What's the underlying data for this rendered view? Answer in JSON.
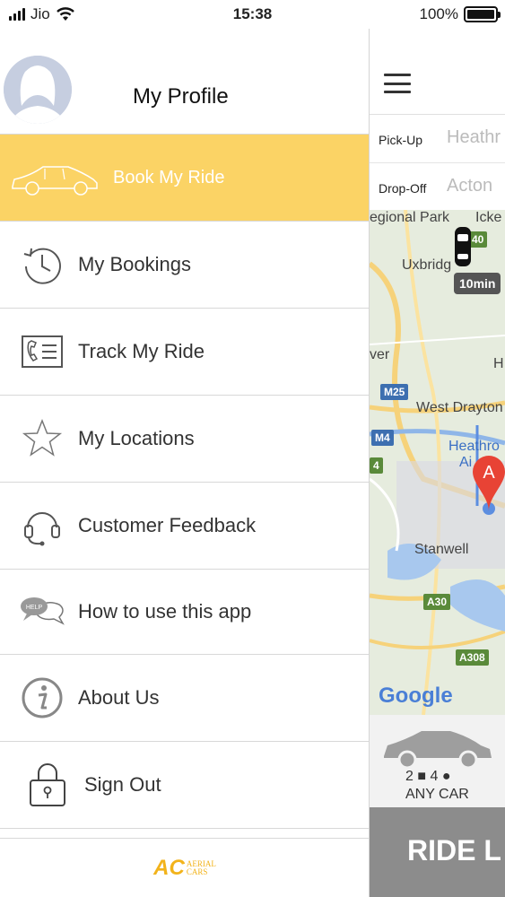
{
  "status_bar": {
    "carrier": "Jio",
    "time": "15:38",
    "battery": "100%"
  },
  "drawer": {
    "profile_title": "My Profile",
    "menu": [
      {
        "label": "Book My Ride",
        "icon": "car-outline-icon",
        "active": true
      },
      {
        "label": "My Bookings",
        "icon": "history-icon"
      },
      {
        "label": "Track My Ride",
        "icon": "contact-card-icon"
      },
      {
        "label": "My Locations",
        "icon": "star-icon"
      },
      {
        "label": "Customer Feedback",
        "icon": "headset-icon"
      },
      {
        "label": "How to use this app",
        "icon": "help-chat-icon"
      },
      {
        "label": "About Us",
        "icon": "info-icon"
      },
      {
        "label": "Sign Out",
        "icon": "lock-icon"
      }
    ],
    "logo": {
      "mark": "AC",
      "line1": "AERIAL",
      "line2": "CARS"
    }
  },
  "app": {
    "pickup_label": "Pick-Up",
    "pickup_value": "Heathr",
    "dropoff_label": "Drop-Off",
    "dropoff_value": "Acton",
    "map": {
      "labels": [
        "egional Park",
        "Icke",
        "Uxbridg",
        "ver",
        "H",
        "West Drayton",
        "Heathro",
        "Ai",
        "Stanwell",
        "Google"
      ],
      "roads": [
        "M25",
        "M4",
        "A30",
        "A308",
        "40",
        "4"
      ],
      "eta": "10min",
      "marker": "A"
    },
    "car": {
      "seats": "2",
      "bags": "4",
      "type": "ANY CAR"
    },
    "ride_button": "RIDE L"
  },
  "colors": {
    "accent": "#fbd365",
    "logo": "#f2b31b",
    "ride_button": "#8c8c8c"
  }
}
